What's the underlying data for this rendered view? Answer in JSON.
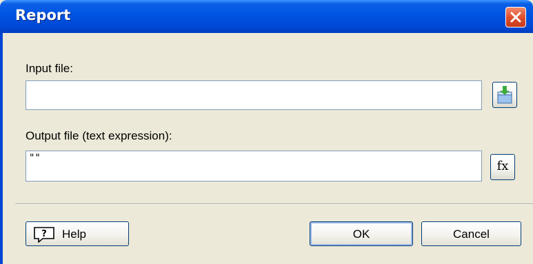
{
  "window": {
    "title": "Report"
  },
  "input": {
    "label": "Input file:",
    "value": ""
  },
  "output": {
    "label": "Output file (text expression):",
    "value": "\"\"",
    "fx_label": "fx"
  },
  "buttons": {
    "help": "Help",
    "ok": "OK",
    "cancel": "Cancel"
  },
  "icons": {
    "close": "close-icon",
    "browse": "open-file-icon",
    "help": "help-icon",
    "fx": "function-icon"
  },
  "colors": {
    "titlebar": "#0054e3",
    "dialog_bg": "#ece9d8",
    "close": "#e0502e"
  }
}
